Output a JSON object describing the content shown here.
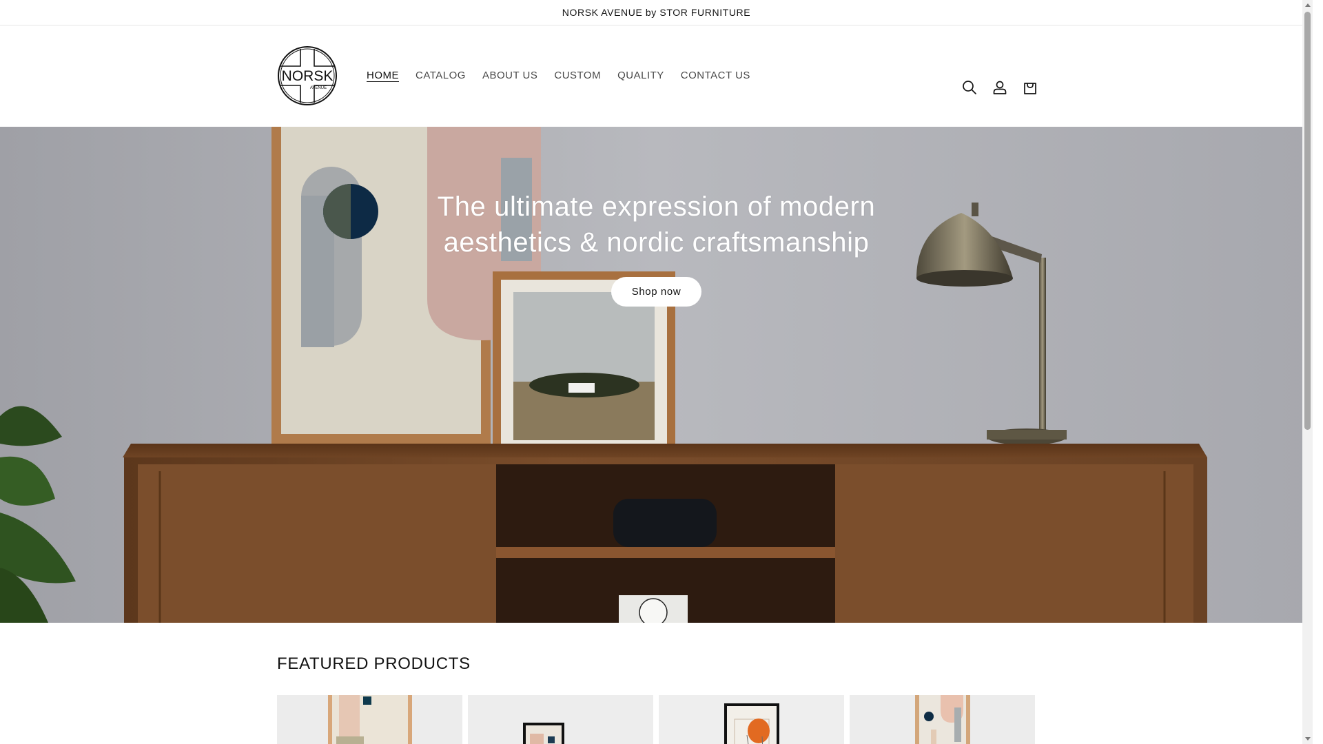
{
  "announcement": {
    "text": "NORSK AVENUE by STOR FURNITURE"
  },
  "header": {
    "logo": {
      "main_text": "NORSK",
      "sub_text": "AVENUE"
    },
    "nav": [
      {
        "label": "HOME",
        "active": true
      },
      {
        "label": "CATALOG",
        "active": false
      },
      {
        "label": "ABOUT US",
        "active": false
      },
      {
        "label": "CUSTOM",
        "active": false
      },
      {
        "label": "QUALITY",
        "active": false
      },
      {
        "label": "CONTACT US",
        "active": false
      }
    ],
    "icons": [
      "search-icon",
      "account-icon",
      "cart-icon"
    ]
  },
  "hero": {
    "heading": "The ultimate expression of modern aesthetics & nordic craftsmanship",
    "button_label": "Shop now"
  },
  "featured": {
    "title": "FEATURED PRODUCTS",
    "products": [
      {
        "image": "abstract-print-1"
      },
      {
        "image": "abstract-print-2"
      },
      {
        "image": "abstract-print-3"
      },
      {
        "image": "abstract-print-4"
      }
    ]
  },
  "colors": {
    "text": "#121212",
    "hero_wall": "#b5b6bb",
    "wood": "#6e4426",
    "button_bg": "#ffffff"
  }
}
